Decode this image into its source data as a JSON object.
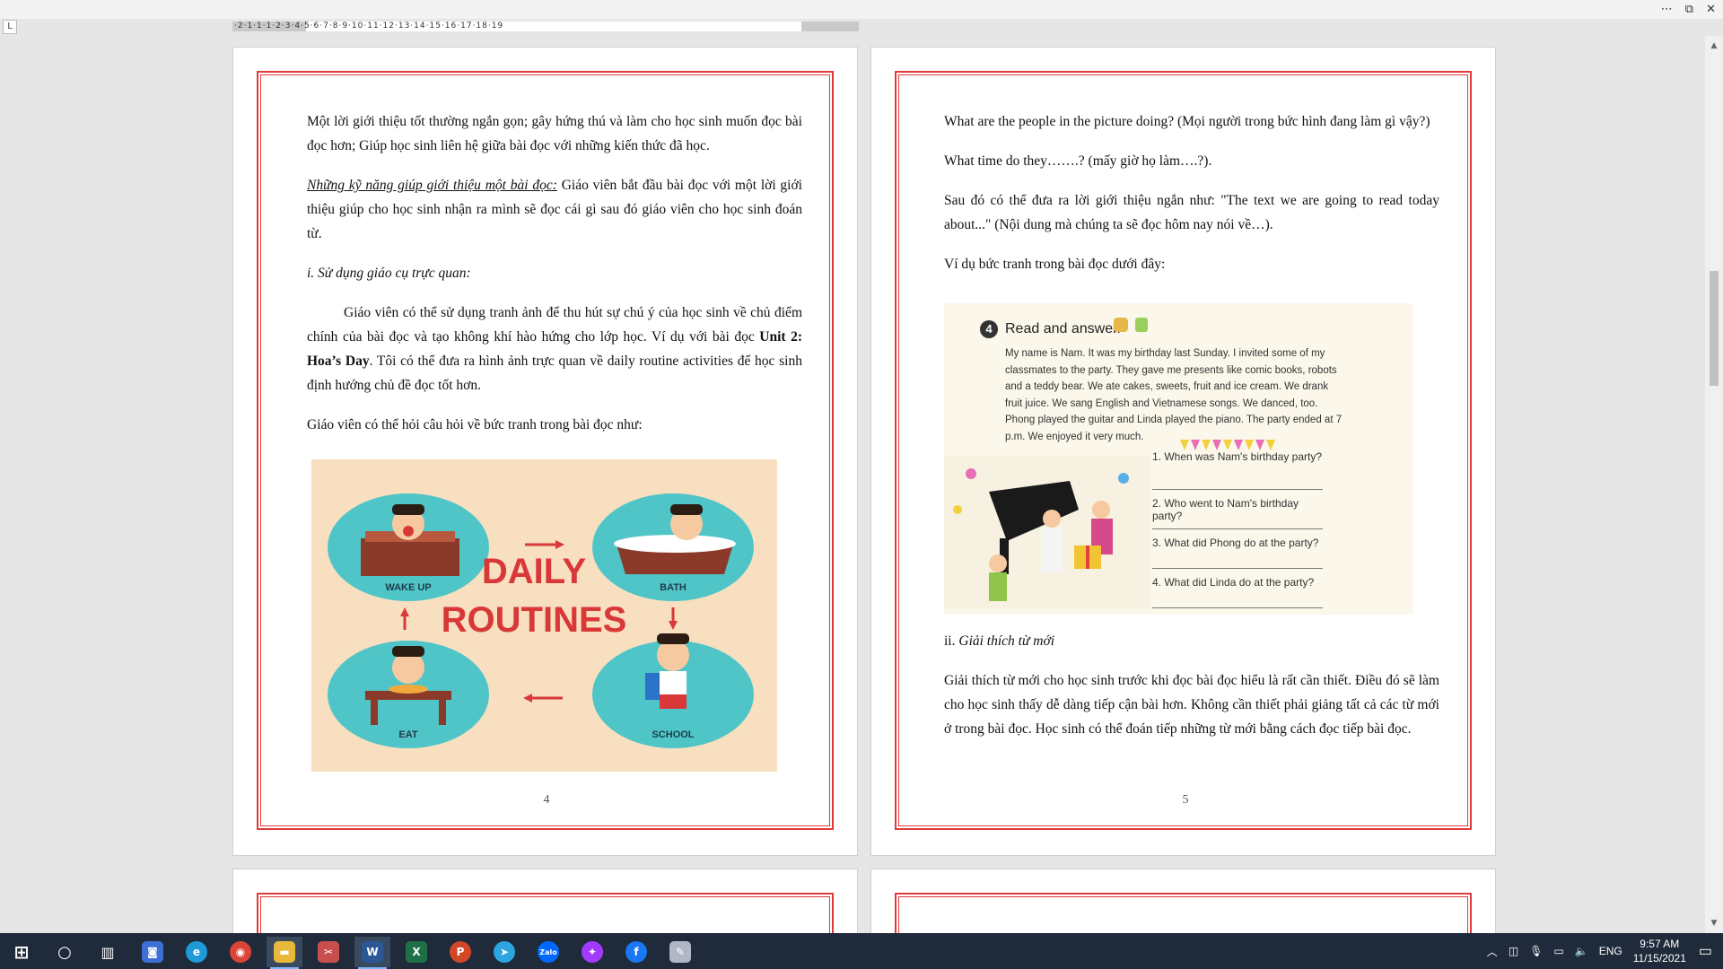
{
  "window": {
    "more_icon": "⋯",
    "restore_icon": "⧉",
    "close_icon": "✕"
  },
  "ruler": {
    "tab_selector": "L",
    "labels": "·2·1·1·1·2·3·4·5·6·7·8·9·10·11·12·13·14·15·16·17·18·19"
  },
  "page4": {
    "paragraphs": [
      "Một lời giới thiệu tốt thường ngắn gọn; gây hứng thú và làm cho học sinh muốn đọc bài đọc hơn; Giúp học sinh liên hệ giữa bài đọc với những kiến thức đã học.",
      "Những kỹ năng giúp giới thiệu một bài đọc:",
      " Giáo viên bắt đầu bài đọc với một lời giới thiệu giúp cho học sinh nhận ra mình sẽ đọc cái gì sau đó giáo viên cho học sinh đoán từ.",
      "i. Sử dụng giáo cụ trực quan:",
      "Giáo viên có thể sử dụng tranh ảnh để thu hút sự chú ý của học sinh về chủ điểm chính của bài đọc và tạo không khí hào hứng cho lớp học. Ví dụ với bài đọc ",
      "Unit 2: Hoa’s Day",
      ". Tôi có thể đưa ra hình ảnh trực quan về daily routine activities để học sinh định hướng chủ đề đọc tốt hơn.",
      "Giáo viên có thể hỏi câu hỏi về bức tranh trong bài đọc như:"
    ],
    "image": {
      "title_line1": "DAILY",
      "title_line2": "ROUTINES",
      "labels": [
        "WAKE UP",
        "BATH",
        "EAT",
        "SCHOOL"
      ]
    },
    "page_number": "4"
  },
  "page5": {
    "paragraphs": [
      "What are the people in the picture doing? (Mọi người trong bức hình đang làm gì vậy?)",
      "What time do they…….? (mấy giờ họ làm….?).",
      "Sau đó có thể đưa ra lời giới thiệu ngắn như: \"The text we are going to read today about...\" (Nội dung mà chúng ta sẽ đọc hôm nay nói về…).",
      "Ví dụ bức tranh trong bài đọc dưới đây:",
      "ii. ",
      "Giải thích từ mới",
      "Giải thích từ mới cho học sinh trước khi đọc bài đọc hiểu là rất cần thiết. Điều đó sẽ làm cho học sinh thấy dễ dàng tiếp cận bài hơn. Không cần thiết phải giảng tất cả các từ mới ở trong bài đọc. Học sinh có thể đoán tiếp những từ mới bằng cách đọc tiếp bài đọc."
    ],
    "image": {
      "number": "4",
      "heading": "Read and answer.",
      "passage": "My name is Nam. It was my birthday last Sunday. I invited some of my classmates to the party. They gave me presents like comic books, robots and a teddy bear. We ate cakes, sweets, fruit and ice cream. We drank fruit juice. We sang English and Vietnamese songs. We danced, too. Phong played the guitar and Linda played the piano. The party ended at 7 p.m. We enjoyed it very much.",
      "questions": [
        "1. When was Nam's birthday party?",
        "2. Who went to Nam's birthday party?",
        "3. What did Phong do at the party?",
        "4. What did Linda do at the party?"
      ]
    },
    "page_number": "5"
  },
  "scrollbar": {
    "up": "▲",
    "down": "▼"
  },
  "taskbar": {
    "apps": [
      {
        "name": "start",
        "glyph": "⊞",
        "color": "#1f2b3a"
      },
      {
        "name": "search",
        "glyph": "○",
        "color": "#1f2b3a"
      },
      {
        "name": "task-view",
        "glyph": "▥",
        "color": "#1f2b3a"
      },
      {
        "name": "teams-chat",
        "glyph": "◙",
        "color": "#3d6fd6"
      },
      {
        "name": "edge",
        "glyph": "e",
        "color": "#1f9ad6"
      },
      {
        "name": "chrome",
        "glyph": "◉",
        "color": "#db4437"
      },
      {
        "name": "file-explorer",
        "glyph": "▬",
        "color": "#e8b83a"
      },
      {
        "name": "snipping",
        "glyph": "✂",
        "color": "#c94f4f"
      },
      {
        "name": "word",
        "glyph": "W",
        "color": "#2b5797"
      },
      {
        "name": "excel",
        "glyph": "X",
        "color": "#1e7145"
      },
      {
        "name": "powerpoint",
        "glyph": "P",
        "color": "#d24726"
      },
      {
        "name": "telegram",
        "glyph": "➤",
        "color": "#2ca5e0"
      },
      {
        "name": "zalo",
        "glyph": "Zalo",
        "color": "#0068ff"
      },
      {
        "name": "messenger",
        "glyph": "✦",
        "color": "#a33bff"
      },
      {
        "name": "facebook",
        "glyph": "f",
        "color": "#1877f2"
      },
      {
        "name": "paint",
        "glyph": "✎",
        "color": "#b0b8c8"
      }
    ],
    "tray": {
      "chevron": "︿",
      "language": "ENG",
      "time": "9:57 AM",
      "date": "11/15/2021",
      "notification_icon": "▭"
    }
  }
}
